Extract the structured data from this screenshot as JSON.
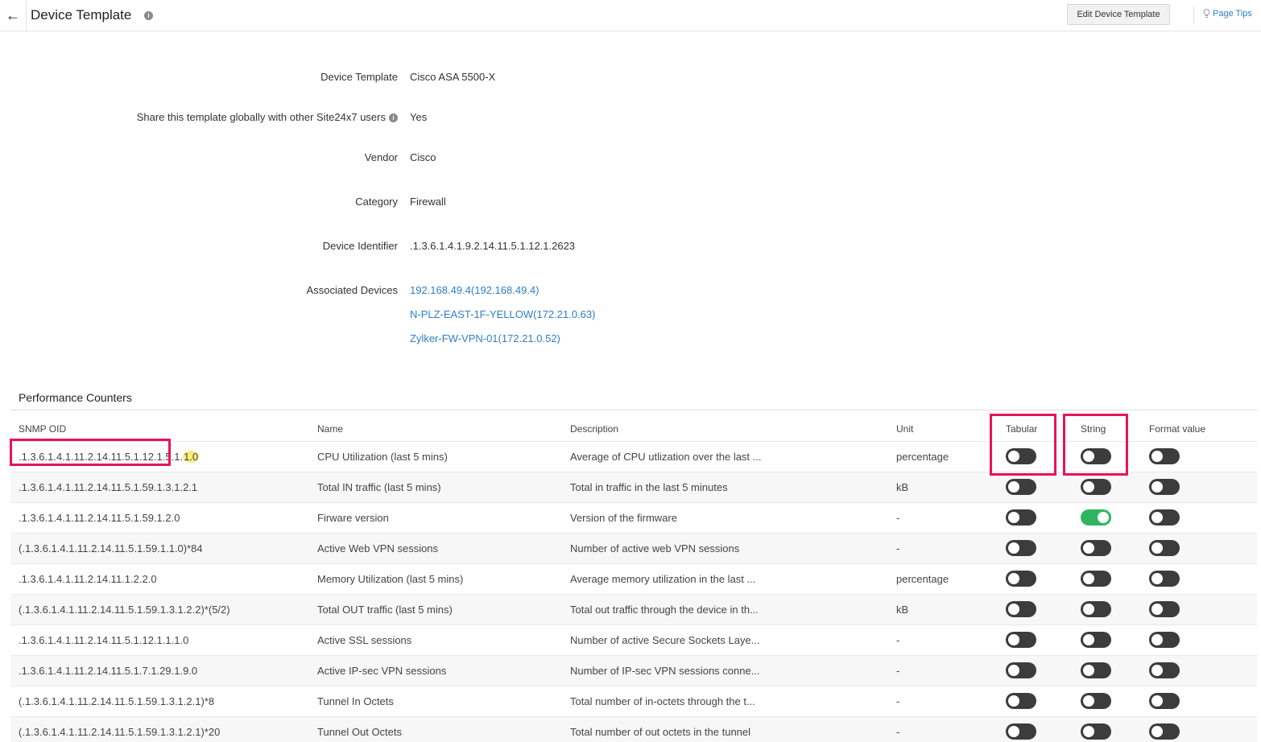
{
  "header": {
    "title": "Device Template",
    "edit_button": "Edit Device Template",
    "page_tips": "Page Tips"
  },
  "details": {
    "device_template": {
      "label": "Device Template",
      "value": "Cisco ASA 5500-X"
    },
    "share": {
      "label": "Share this template globally with other Site24x7 users",
      "value": "Yes"
    },
    "vendor": {
      "label": "Vendor",
      "value": "Cisco"
    },
    "category": {
      "label": "Category",
      "value": "Firewall"
    },
    "device_identifier": {
      "label": "Device Identifier",
      "value": ".1.3.6.1.4.1.9.2.14.11.5.1.12.1.2623"
    },
    "associated_devices": {
      "label": "Associated Devices",
      "items": [
        "192.168.49.4(192.168.49.4)",
        "N-PLZ-EAST-1F-YELLOW(172.21.0.63)",
        "Zylker-FW-VPN-01(172.21.0.52)"
      ]
    }
  },
  "performance_counters": {
    "title": "Performance Counters",
    "columns": [
      "SNMP OID",
      "Name",
      "Description",
      "Unit",
      "Tabular",
      "String",
      "Format value"
    ],
    "rows": [
      {
        "oid": ".1.3.6.1.4.1.11.2.14.11.5.1.12.1.5.1.",
        "oid_mark": "1.0",
        "name": "CPU Utilization (last 5 mins)",
        "description": "Average of CPU utlization over the last ...",
        "unit": "percentage",
        "tabular": false,
        "string": false,
        "format": false
      },
      {
        "oid": ".1.3.6.1.4.1.11.2.14.11.5.1.59.1.3.1.2.1",
        "name": "Total IN traffic (last 5 mins)",
        "description": "Total in traffic in the last 5 minutes",
        "unit": "kB",
        "tabular": false,
        "string": false,
        "format": false
      },
      {
        "oid": ".1.3.6.1.4.1.11.2.14.11.5.1.59.1.2.0",
        "name": "Firware version",
        "description": "Version of the firmware",
        "unit": "-",
        "tabular": false,
        "string": true,
        "format": false
      },
      {
        "oid": "(.1.3.6.1.4.1.11.2.14.11.5.1.59.1.1.0)*84",
        "name": "Active Web VPN sessions",
        "description": "Number of active web VPN sessions",
        "unit": "-",
        "tabular": false,
        "string": false,
        "format": false
      },
      {
        "oid": ".1.3.6.1.4.1.11.2.14.11.1.2.2.0",
        "name": "Memory Utilization (last 5 mins)",
        "description": "Average memory utilization in the last ...",
        "unit": "percentage",
        "tabular": false,
        "string": false,
        "format": false
      },
      {
        "oid": "(.1.3.6.1.4.1.11.2.14.11.5.1.59.1.3.1.2.2)*(5/2)",
        "name": "Total OUT traffic (last 5 mins)",
        "description": "Total out traffic through the device in th...",
        "unit": "kB",
        "tabular": false,
        "string": false,
        "format": false
      },
      {
        "oid": ".1.3.6.1.4.1.11.2.14.11.5.1.12.1.1.1.0",
        "name": "Active SSL sessions",
        "description": "Number of active Secure Sockets Laye...",
        "unit": "-",
        "tabular": false,
        "string": false,
        "format": false
      },
      {
        "oid": ".1.3.6.1.4.1.11.2.14.11.5.1.7.1.29.1.9.0",
        "name": "Active IP-sec VPN sessions",
        "description": "Number of IP-sec VPN sessions conne...",
        "unit": "-",
        "tabular": false,
        "string": false,
        "format": false
      },
      {
        "oid": "(.1.3.6.1.4.1.11.2.14.11.5.1.59.1.3.1.2.1)*8",
        "name": "Tunnel In Octets",
        "description": "Total number of in-octets through the t...",
        "unit": "-",
        "tabular": false,
        "string": false,
        "format": false
      },
      {
        "oid": "(.1.3.6.1.4.1.11.2.14.11.5.1.59.1.3.1.2.1)*20",
        "name": "Tunnel Out Octets",
        "description": "Total number of out octets in the tunnel",
        "unit": "-",
        "tabular": false,
        "string": false,
        "format": false
      }
    ]
  },
  "colors": {
    "link": "#2f7ec7",
    "toggle_on": "#2fb561",
    "toggle_off": "#3c3c3c",
    "annotation": "#e8135a"
  }
}
